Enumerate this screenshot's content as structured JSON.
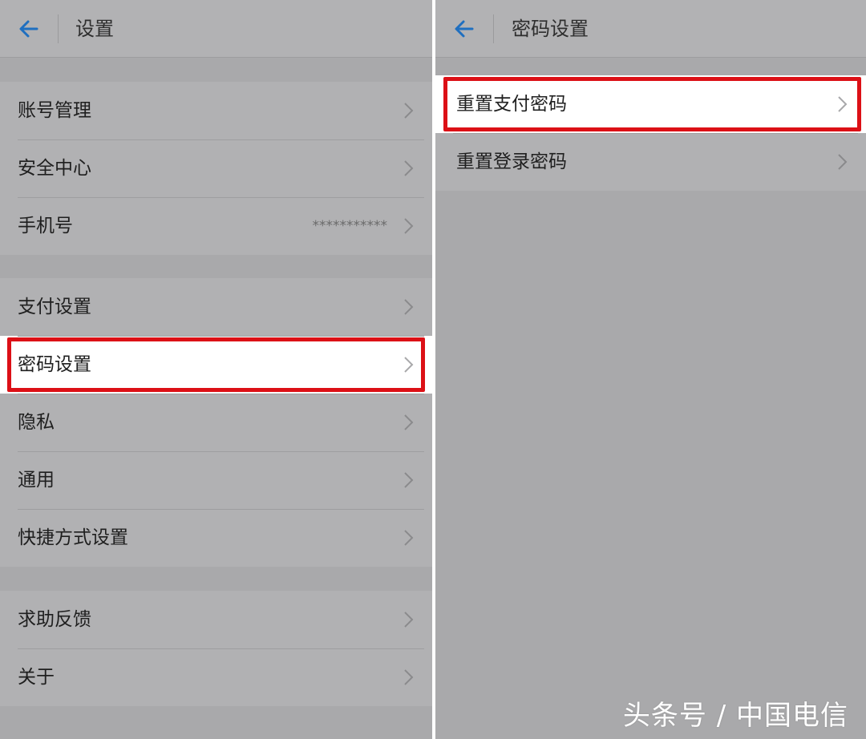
{
  "left": {
    "title": "设置",
    "groups": [
      {
        "items": [
          {
            "label": "账号管理"
          },
          {
            "label": "安全中心"
          },
          {
            "label": "手机号",
            "value": "***********"
          }
        ]
      },
      {
        "items": [
          {
            "label": "支付设置"
          },
          {
            "label": "密码设置",
            "highlighted": true
          },
          {
            "label": "隐私"
          },
          {
            "label": "通用"
          },
          {
            "label": "快捷方式设置"
          }
        ]
      },
      {
        "items": [
          {
            "label": "求助反馈"
          },
          {
            "label": "关于"
          }
        ]
      }
    ]
  },
  "right": {
    "title": "密码设置",
    "items": [
      {
        "label": "重置支付密码",
        "highlighted": true
      },
      {
        "label": "重置登录密码"
      }
    ]
  },
  "watermark": "头条号 / 中国电信",
  "colors": {
    "accent": "#1f6fc0",
    "highlight_border": "#dc1016",
    "overlay_bg": "#a9a9ab"
  },
  "icons": {
    "back": "arrow-left-icon",
    "chevron": "chevron-right-icon"
  }
}
